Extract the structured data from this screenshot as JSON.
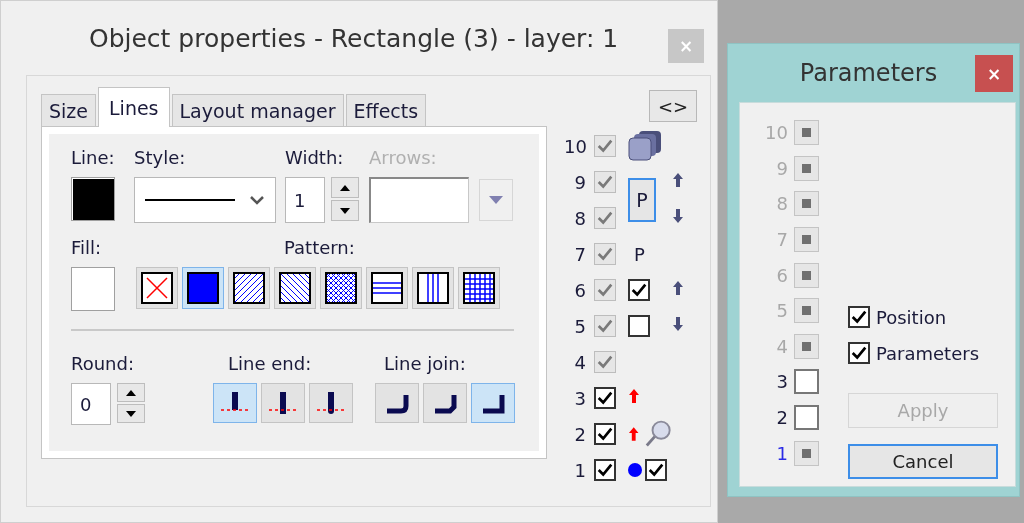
{
  "main_window": {
    "title": "Object properties - Rectangle (3) - layer: 1",
    "close": "×"
  },
  "tabs": [
    {
      "label": "Size",
      "selected": false
    },
    {
      "label": "Lines",
      "selected": true
    },
    {
      "label": "Layout manager",
      "selected": false
    },
    {
      "label": "Effects",
      "selected": false
    }
  ],
  "toggle_button": "<>",
  "line": {
    "label": "Line:"
  },
  "style": {
    "label": "Style:"
  },
  "width": {
    "label": "Width:",
    "value": "1"
  },
  "arrows": {
    "label": "Arrows:",
    "disabled": true
  },
  "fill": {
    "label": "Fill:"
  },
  "pattern": {
    "label": "Pattern:",
    "items": [
      {
        "kind": "none",
        "selected": false
      },
      {
        "kind": "solid",
        "selected": true
      },
      {
        "kind": "fdiag",
        "selected": false
      },
      {
        "kind": "bdiag",
        "selected": false
      },
      {
        "kind": "diagcross",
        "selected": false
      },
      {
        "kind": "horizontal",
        "selected": false
      },
      {
        "kind": "vertical",
        "selected": false
      },
      {
        "kind": "cross",
        "selected": false
      }
    ]
  },
  "round": {
    "label": "Round:",
    "value": "0"
  },
  "line_end": {
    "label": "Line end:",
    "items": [
      {
        "kind": "flat",
        "selected": true
      },
      {
        "kind": "square",
        "selected": false
      },
      {
        "kind": "round",
        "selected": false
      }
    ]
  },
  "line_join": {
    "label": "Line join:",
    "items": [
      {
        "kind": "round",
        "selected": false
      },
      {
        "kind": "bevel",
        "selected": false
      },
      {
        "kind": "miter",
        "selected": true
      }
    ]
  },
  "layers": [
    {
      "number": "10",
      "checked": true,
      "disabled": true
    },
    {
      "number": "9",
      "checked": true,
      "disabled": true
    },
    {
      "number": "8",
      "checked": true,
      "disabled": true
    },
    {
      "number": "7",
      "checked": true,
      "disabled": true
    },
    {
      "number": "6",
      "checked": true,
      "disabled": true
    },
    {
      "number": "5",
      "checked": true,
      "disabled": true
    },
    {
      "number": "4",
      "checked": true,
      "disabled": true
    },
    {
      "number": "3",
      "checked": true,
      "disabled": false
    },
    {
      "number": "2",
      "checked": true,
      "disabled": false
    },
    {
      "number": "1",
      "checked": true,
      "disabled": false
    }
  ],
  "p_button": {
    "label": "P",
    "selected": true
  },
  "p_label": "P",
  "move_up": {
    "checked": true
  },
  "move_down": {
    "checked": false
  },
  "marker": {
    "checked": true
  },
  "parameters_window": {
    "title": "Parameters",
    "close": "×",
    "layers": [
      {
        "number": "10",
        "disabled": true,
        "current": false
      },
      {
        "number": "9",
        "disabled": true,
        "current": false
      },
      {
        "number": "8",
        "disabled": true,
        "current": false
      },
      {
        "number": "7",
        "disabled": true,
        "current": false
      },
      {
        "number": "6",
        "disabled": true,
        "current": false
      },
      {
        "number": "5",
        "disabled": true,
        "current": false
      },
      {
        "number": "4",
        "disabled": true,
        "current": false
      },
      {
        "number": "3",
        "disabled": false,
        "current": false
      },
      {
        "number": "2",
        "disabled": false,
        "current": false
      },
      {
        "number": "1",
        "disabled": true,
        "current": true
      }
    ],
    "options": [
      {
        "label": "Position",
        "checked": true
      },
      {
        "label": "Parameters",
        "checked": true
      }
    ],
    "buttons": [
      {
        "label": "Apply",
        "disabled": true,
        "focused": false
      },
      {
        "label": "Cancel",
        "disabled": false,
        "focused": true
      }
    ]
  }
}
